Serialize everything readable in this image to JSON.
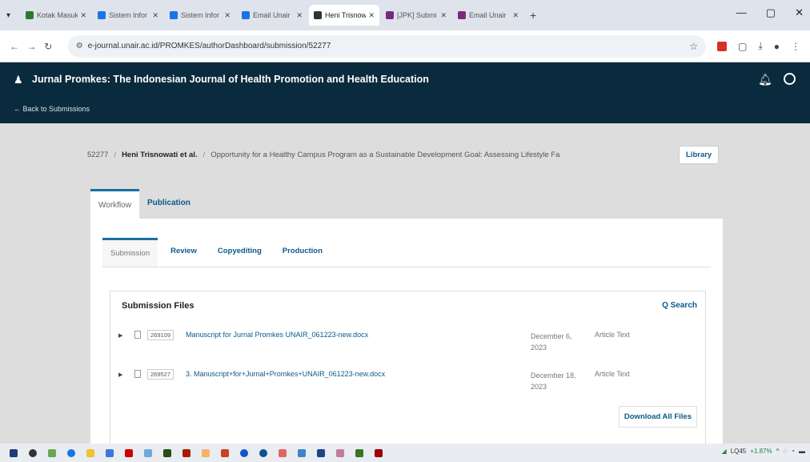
{
  "browser": {
    "tabs": [
      {
        "title": "Kotak Masuk",
        "color": "#2a7a2a",
        "active": false
      },
      {
        "title": "Sistem Infor",
        "color": "#1a73e8",
        "active": false
      },
      {
        "title": "Sistem Infor",
        "color": "#1a73e8",
        "active": false
      },
      {
        "title": "Email Unair",
        "color": "#1a73e8",
        "active": false
      },
      {
        "title": "Heni Trisnow",
        "color": "#333333",
        "active": true
      },
      {
        "title": "[JPK] Submi",
        "color": "#7a2a7a",
        "active": false
      },
      {
        "title": "Email Unair",
        "color": "#7a2a7a",
        "active": false
      }
    ],
    "url": "e-journal.unair.ac.id/PROMKES/authorDashboard/submission/52277"
  },
  "header": {
    "title": "Jurnal Promkes: The Indonesian Journal of Health Promotion and Health Education",
    "back_label": "← Back to Submissions"
  },
  "submission": {
    "id": "52277",
    "authors": "Heni Trisnowati et al.",
    "title": "Opportunity for a Healthy Campus Program as a Sustainable Development Goal: Assessing Lifestyle Fa",
    "library_label": "Library"
  },
  "main_tabs": {
    "workflow": "Workflow",
    "publication": "Publication"
  },
  "sub_tabs": {
    "submission": "Submission",
    "review": "Review",
    "copyediting": "Copyediting",
    "production": "Production"
  },
  "files": {
    "title": "Submission Files",
    "search_label": "Q Search",
    "rows": [
      {
        "id": "269109",
        "name": "Manuscript for Jurnal Promkes UNAIR_061223-new.docx",
        "date": "December 6, 2023",
        "type": "Article Text"
      },
      {
        "id": "269527",
        "name": "3. Manuscript+for+Jurnal+Promkes+UNAIR_061223-new.docx",
        "date": "December 18, 2023",
        "type": "Article Text"
      }
    ],
    "download_label": "Download All Files"
  },
  "taskbar": {
    "tray_label": "LQ45",
    "tray_change": "+1.87%"
  }
}
